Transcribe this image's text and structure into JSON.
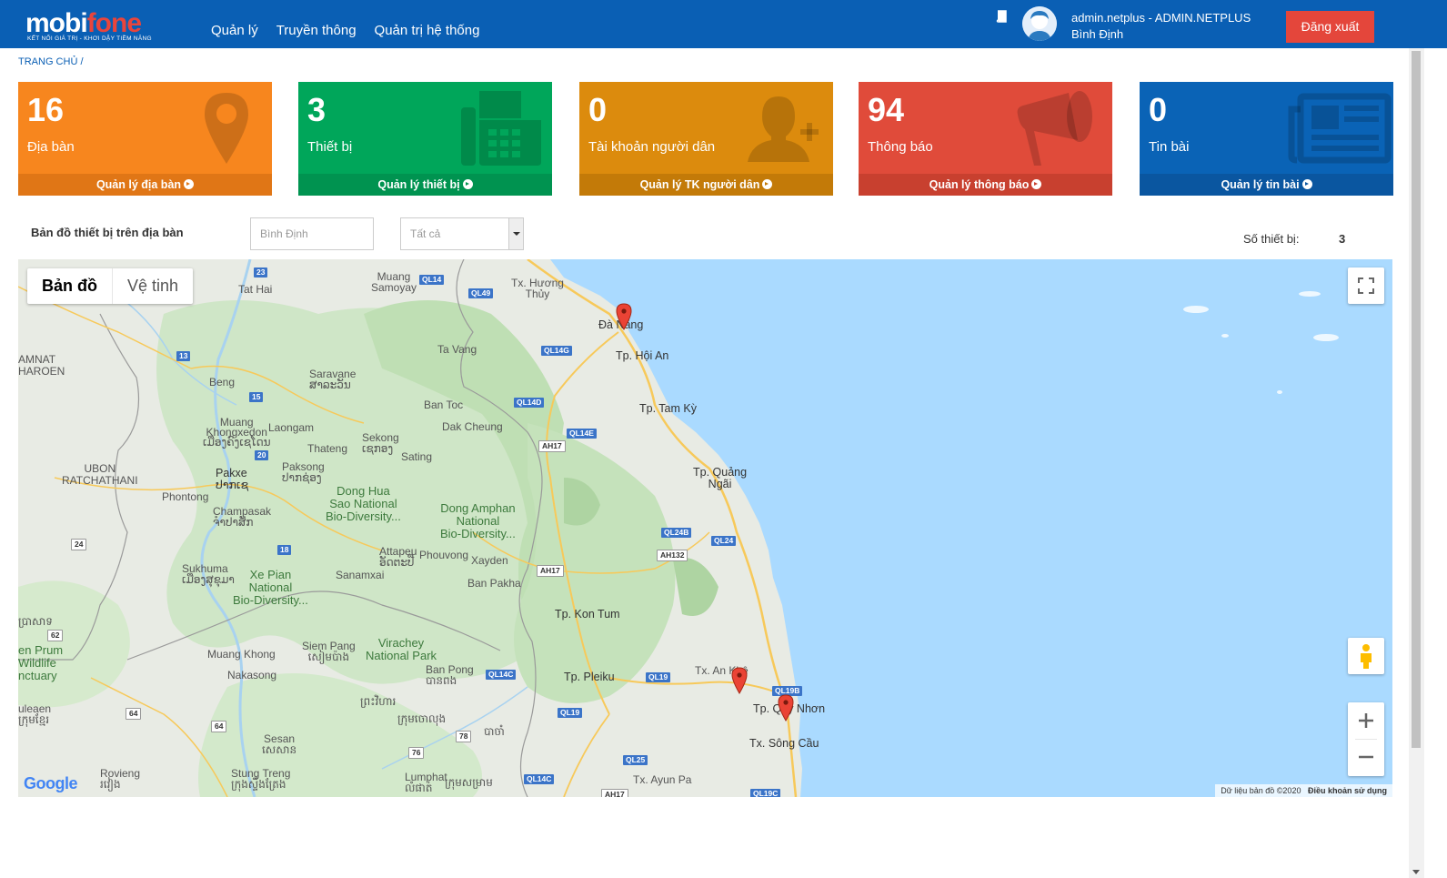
{
  "header": {
    "brand_left": "mobi",
    "brand_right": "fone",
    "slogan": "KẾT NỐI GIÁ TRỊ - KHƠI DẬY TIỀM NĂNG",
    "nav": [
      "Quản lý",
      "Truyền thông",
      "Quản trị hệ thống"
    ],
    "user_name": "admin.netplus - ADMIN.NETPLUS",
    "user_region": "Bình Định",
    "logout_label": "Đăng xuất"
  },
  "breadcrumb": "TRANG CHỦ  /",
  "cards": [
    {
      "value": "16",
      "label": "Địa bàn",
      "link": "Quản lý địa bàn",
      "color": "#f7861e",
      "foot_color": "#e07616",
      "icon": "map-pin-icon"
    },
    {
      "value": "3",
      "label": "Thiết bị",
      "link": "Quản lý thiết bị",
      "color": "#00a65a",
      "foot_color": "#009350",
      "icon": "fax-icon"
    },
    {
      "value": "0",
      "label": "Tài khoản người dân",
      "link": "Quản lý TK người dân",
      "color": "#dc8b0d",
      "foot_color": "#c37a08",
      "icon": "user-plus-icon"
    },
    {
      "value": "94",
      "label": "Thông báo",
      "link": "Quản lý thông báo",
      "color": "#e04b3a",
      "foot_color": "#c8402f",
      "icon": "bullhorn-icon"
    },
    {
      "value": "0",
      "label": "Tin bài",
      "link": "Quản lý tin bài",
      "color": "#0a63b6",
      "foot_color": "#0a56a0",
      "icon": "newspaper-icon"
    }
  ],
  "filter": {
    "title": "Bản đồ thiết bị trên địa bàn",
    "region_placeholder": "Bình Định",
    "status_selected": "Tất cả",
    "device_label": "Số thiết bị:",
    "device_count": "3"
  },
  "map": {
    "type_map": "Bản đồ",
    "type_satellite": "Vệ tinh",
    "google": "Google",
    "attribution": "Dữ liệu bản đồ ©2020",
    "terms": "Điều khoản sử dụng",
    "labels": {
      "tat_hai": "Tat Hai",
      "muang_samoyay": "Muang\nSamoyay",
      "tx_huong_thuy": "Tx. Hương\nThủy",
      "da_nang": "Đà Nẵng",
      "tp_hoi_an": "Tp. Hội An",
      "ta_vang": "Ta Vang",
      "amnat": "AMNAT\nHAROEN",
      "saravane": "Saravane\nສາລະວັນ",
      "beng": "Beng",
      "ban_toc": "Ban Toc",
      "tp_tam_ky": "Tp. Tam Kỳ",
      "muang_khong": "Muang\nKhongxedon\nເມືອງຄົງເຊໂດນ",
      "laongam": "Laongam",
      "sekong": "Sekong\nເຊກອງ",
      "dak_cheung": "Dak Cheung",
      "thateng": "Thateng",
      "sating": "Sating",
      "ubon": "UBON\nRATCHATHANI",
      "pakxe": "Pakxe\nປາກເຊ",
      "paksong": "Paksong\nປາກຊ່ອງ",
      "tp_quang_ngai": "Tp. Quảng\nNgãi",
      "phontong": "Phontong",
      "dong_hua": "Dong Hua\nSao National\nBio-Diversity...",
      "dong_amphan": "Dong Amphan\nNational\nBio-Diversity...",
      "champasak": "Champasak\nຈຳປາສັກ",
      "attapeu": "Attapeu\nອັດຕະປື",
      "phouvong": "Phouvong",
      "xayden": "Xayden",
      "sukhuma": "Sukhuma\nເມືອງສຸຂຸມາ",
      "sanamxai": "Sanamxai",
      "ban_pakha": "Ban Pakha",
      "xe_pian": "Xe Pian\nNational\nBio-Diversity...",
      "tp_kon_tum": "Tp. Kon Tum",
      "en_prum": "en Prum\nWildlife\nnctuary",
      "muang_khong2": "Muang Khong",
      "siem_pang": "Siem Pang\nសៀមប៉ាង",
      "virachey": "Virachey\nNational Park",
      "nakasong": "Nakasong",
      "ban_pong": "Ban Pong\nបានពង",
      "tp_pleiku": "Tp. Pleiku",
      "tx_an_khe": "Tx. An Khê",
      "tp_quy_nhon": "Tp. Quy Nhơn",
      "tx_song_cau": "Tx. Sông Cầu",
      "ulean": "uleaen\nក្រុមខ្មែរ",
      "sesan": "Sesan\nសេសាន",
      "kratie": "ក្រុមចោលុង",
      "lumphat": "Lumphat\nលំផាត់",
      "rovieng": "Rovieng\nរវៀង",
      "stung_treng": "Stung Treng\nក្រុងស្ទឹងត្រែង",
      "tx_ayun_pa": "Tx. Ayun Pa",
      "thai1": "ព្រះវិហារ",
      "thai2": "បាចាំ",
      "c1": "ប្រាសាទ",
      "c2": "ក្រុមសម្រាម"
    },
    "shields": {
      "s23": "23",
      "ql14": "QL14",
      "ql49": "QL49",
      "s13": "13",
      "ql14g": "QL14G",
      "s15": "15",
      "ql14d": "QL14D",
      "ql14e": "QL14E",
      "ah17": "AH17",
      "s20": "20",
      "ql24b": "QL24B",
      "ql24": "QL24",
      "ah132": "AH132",
      "s18": "18",
      "ah17b": "AH17",
      "s24": "24",
      "s62": "62",
      "s64": "64",
      "s64b": "64",
      "ql14c": "QL14C",
      "ql19": "QL19",
      "ql19b": "QL19B",
      "ql19c": "QL19",
      "s76": "76",
      "s78": "78",
      "ql25": "QL25",
      "ql14c2": "QL14C",
      "ah17c": "AH17",
      "ql19c2": "QL19C"
    }
  }
}
